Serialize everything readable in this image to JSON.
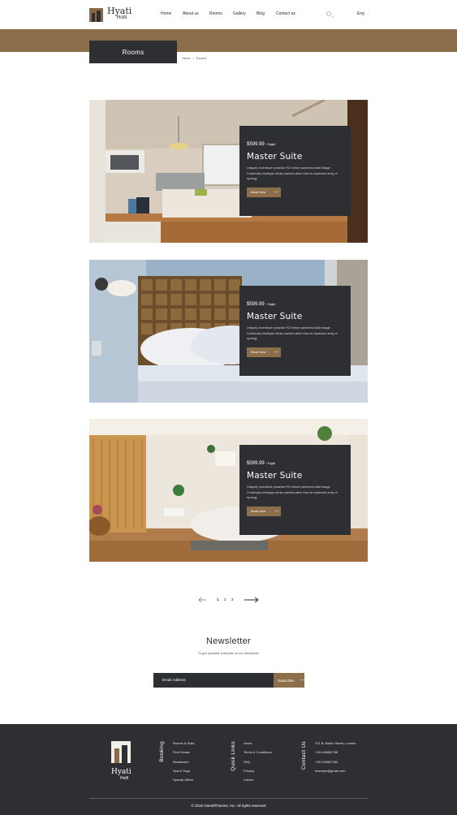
{
  "header": {
    "logo": {
      "name": "Hyati",
      "sub": "Hotll"
    },
    "nav": [
      "Home",
      "About us",
      "Rooms",
      "Gallery",
      "Blog",
      "Contact us"
    ],
    "language": "Eng"
  },
  "page": {
    "title": "Rooms",
    "breadcrumb": [
      "Home",
      "/",
      "Rooms"
    ]
  },
  "rooms": [
    {
      "price": "$599.99",
      "per": "/ Night",
      "title": "Master Suite",
      "description": "Uniquely incentivize proactive ROI before pandemic total linkage. Continually strategize sticky markets rather than an expanded array of synergy",
      "button": "Book Now",
      "image": "hotel-room-photo"
    },
    {
      "price": "$599.99",
      "per": "/ Night",
      "title": "Master Suite",
      "description": "Uniquely incentivize proactive ROI before pandemic total linkage. Continually strategize sticky markets rather than an expanded array of synergy",
      "button": "Book Now",
      "image": "bed-headboard-photo"
    },
    {
      "price": "$599.99",
      "per": "/ Night",
      "title": "Master Suite",
      "description": "Uniquely incentivize proactive ROI before pandemic total linkage. Continually strategize sticky markets rather than an expanded array of synergy",
      "button": "Book Now",
      "image": "bright-bedroom-photo"
    }
  ],
  "pagination": {
    "pages": [
      "1",
      "2",
      "3"
    ],
    "current": "1"
  },
  "newsletter": {
    "title": "Newsletter",
    "subtitle": "To get updated subscribe to our newsletter",
    "placeholder": "Email Address",
    "button": "Subscribe"
  },
  "footer": {
    "logo": {
      "name": "Hyati",
      "sub": "Hotll"
    },
    "booking": {
      "heading": "Booking",
      "items": [
        "Rooms & Suits",
        "Pent House",
        "Restaurant",
        "Spa & Yoga",
        "Special Offers"
      ]
    },
    "quick_links": {
      "heading": "Quick Links",
      "items": [
        "Home",
        "Terms & Conditions",
        "FAQ",
        "Privacy",
        "Career"
      ]
    },
    "contact": {
      "heading": "Contact Us",
      "items": [
        "231 B, Baker Street, London",
        "+010-85852786",
        "+010-89567484",
        "example@gmail.com"
      ]
    },
    "copyright": "© 2019 GamelThemes, Inc. All rights reserved"
  },
  "colors": {
    "accent": "#8d6e4b",
    "dark": "#2e2f33"
  }
}
